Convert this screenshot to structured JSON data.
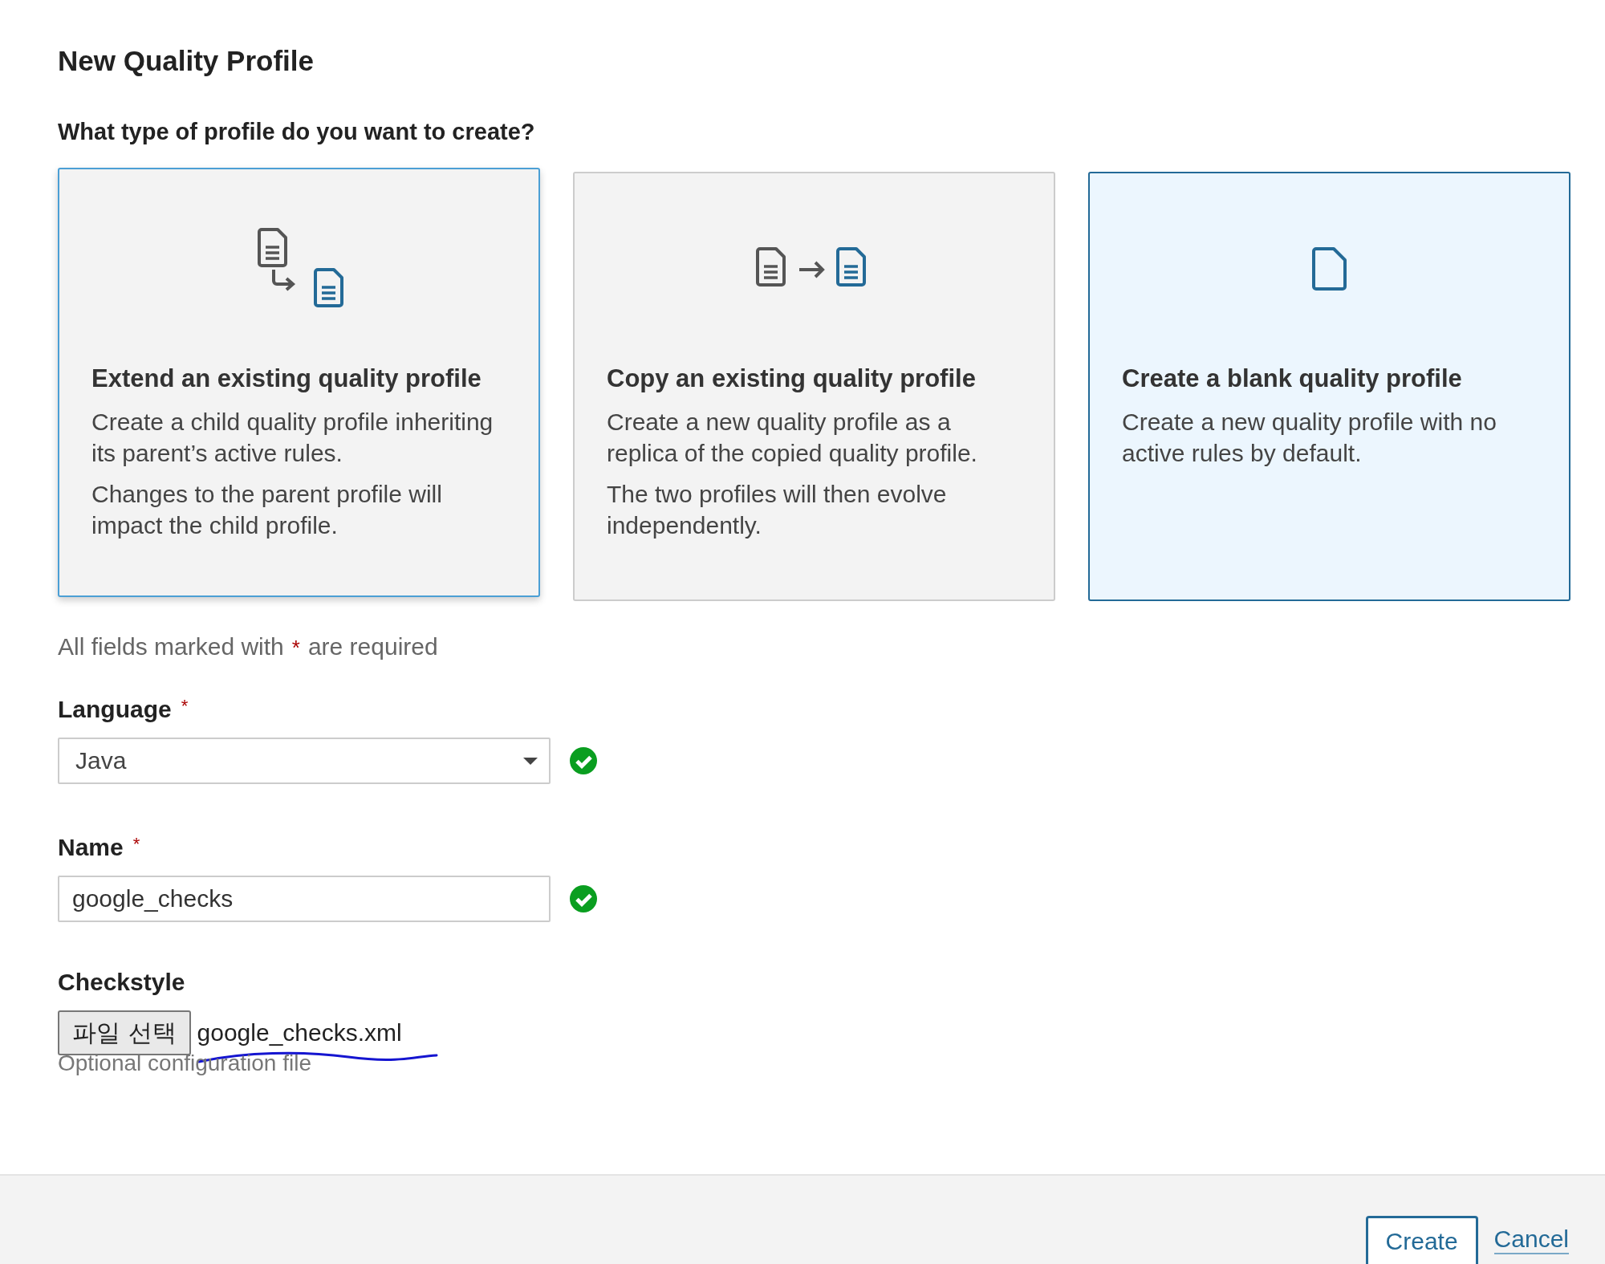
{
  "title": "New Quality Profile",
  "question": "What type of profile do you want to create?",
  "cards": [
    {
      "kind": "extend",
      "title": "Extend an existing quality profile",
      "paragraphs": [
        "Create a child quality profile inheriting its parent’s active rules.",
        "Changes to the parent profile will impact the child profile."
      ],
      "selected": false,
      "hovered": true
    },
    {
      "kind": "copy",
      "title": "Copy an existing quality profile",
      "paragraphs": [
        "Create a new quality profile as a replica of the copied quality profile.",
        "The two profiles will then evolve independently."
      ],
      "selected": false,
      "hovered": false
    },
    {
      "kind": "blank",
      "title": "Create a blank quality profile",
      "paragraphs": [
        "Create a new quality profile with no active rules by default."
      ],
      "selected": true,
      "hovered": false
    }
  ],
  "required_note": {
    "before": "All fields marked with",
    "mark": "*",
    "after": "are required"
  },
  "fields": [
    {
      "kind": "select",
      "label": "Language",
      "required_mark": "*",
      "value": "Java",
      "valid": true
    },
    {
      "kind": "text",
      "label": "Name",
      "required_mark": "*",
      "value": "google_checks",
      "valid": true
    },
    {
      "kind": "file",
      "label": "Checkstyle",
      "button": "파일 선택",
      "value": "google_checks.xml",
      "help": "Optional configuration file",
      "pen_underline": true
    }
  ],
  "footer": {
    "buttons": [
      {
        "kind": "primary",
        "label": "Create"
      },
      {
        "kind": "link",
        "label": "Cancel"
      }
    ]
  }
}
